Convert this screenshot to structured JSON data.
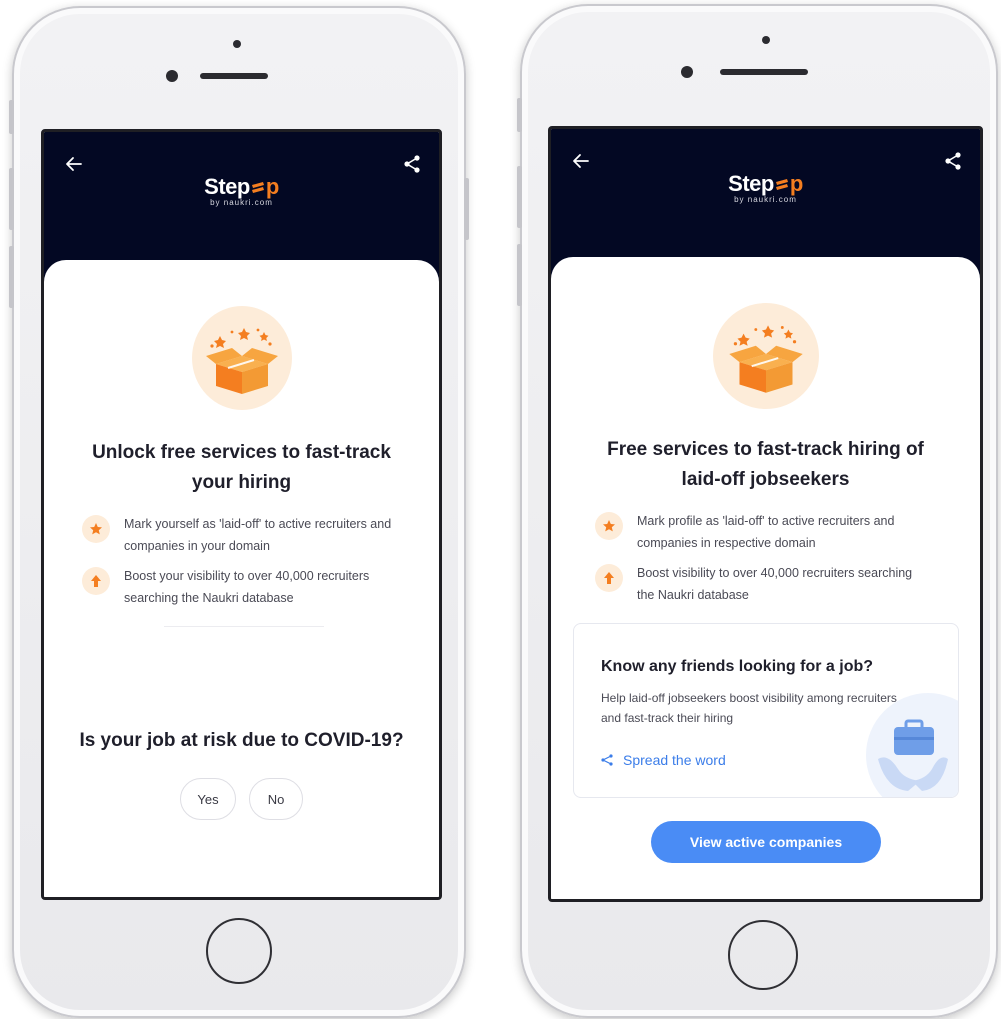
{
  "colors": {
    "header_bg": "#030823",
    "accent_orange": "#f47e20",
    "soft_orange": "#fdecd9",
    "link_blue": "#3b7de9",
    "cta_blue": "#4a8cf5"
  },
  "brand": {
    "logo_text_start": "Step",
    "logo_text_end": "p",
    "logo_sub": "by naukri.com"
  },
  "icons": {
    "back": "arrow-left-icon",
    "share": "share-icon",
    "gift": "gift-box-icon",
    "star": "star-icon",
    "up_arrow": "arrow-up-icon",
    "hands": "hands-briefcase-icon"
  },
  "left_screen": {
    "title": "Unlock free services to fast-track your hiring",
    "bullets": [
      {
        "icon": "star-icon",
        "text": "Mark yourself as 'laid-off' to active recruiters and companies in your domain"
      },
      {
        "icon": "arrow-up-icon",
        "text": "Boost your visibility to over 40,000 recruiters searching the Naukri database"
      }
    ],
    "question": "Is your job at risk due to COVID-19?",
    "answers": [
      "Yes",
      "No"
    ]
  },
  "right_screen": {
    "title": "Free services to fast-track hiring of laid-off jobseekers",
    "bullets": [
      {
        "icon": "star-icon",
        "text": "Mark profile as 'laid-off' to active recruiters and companies in respective domain"
      },
      {
        "icon": "arrow-up-icon",
        "text": "Boost visibility to over 40,000 recruiters searching the Naukri database"
      }
    ],
    "friends_card": {
      "title": "Know any friends looking for a job?",
      "description": "Help laid-off jobseekers boost visibility among recruiters and fast-track their hiring",
      "link": "Spread the word"
    },
    "cta": "View active companies"
  }
}
